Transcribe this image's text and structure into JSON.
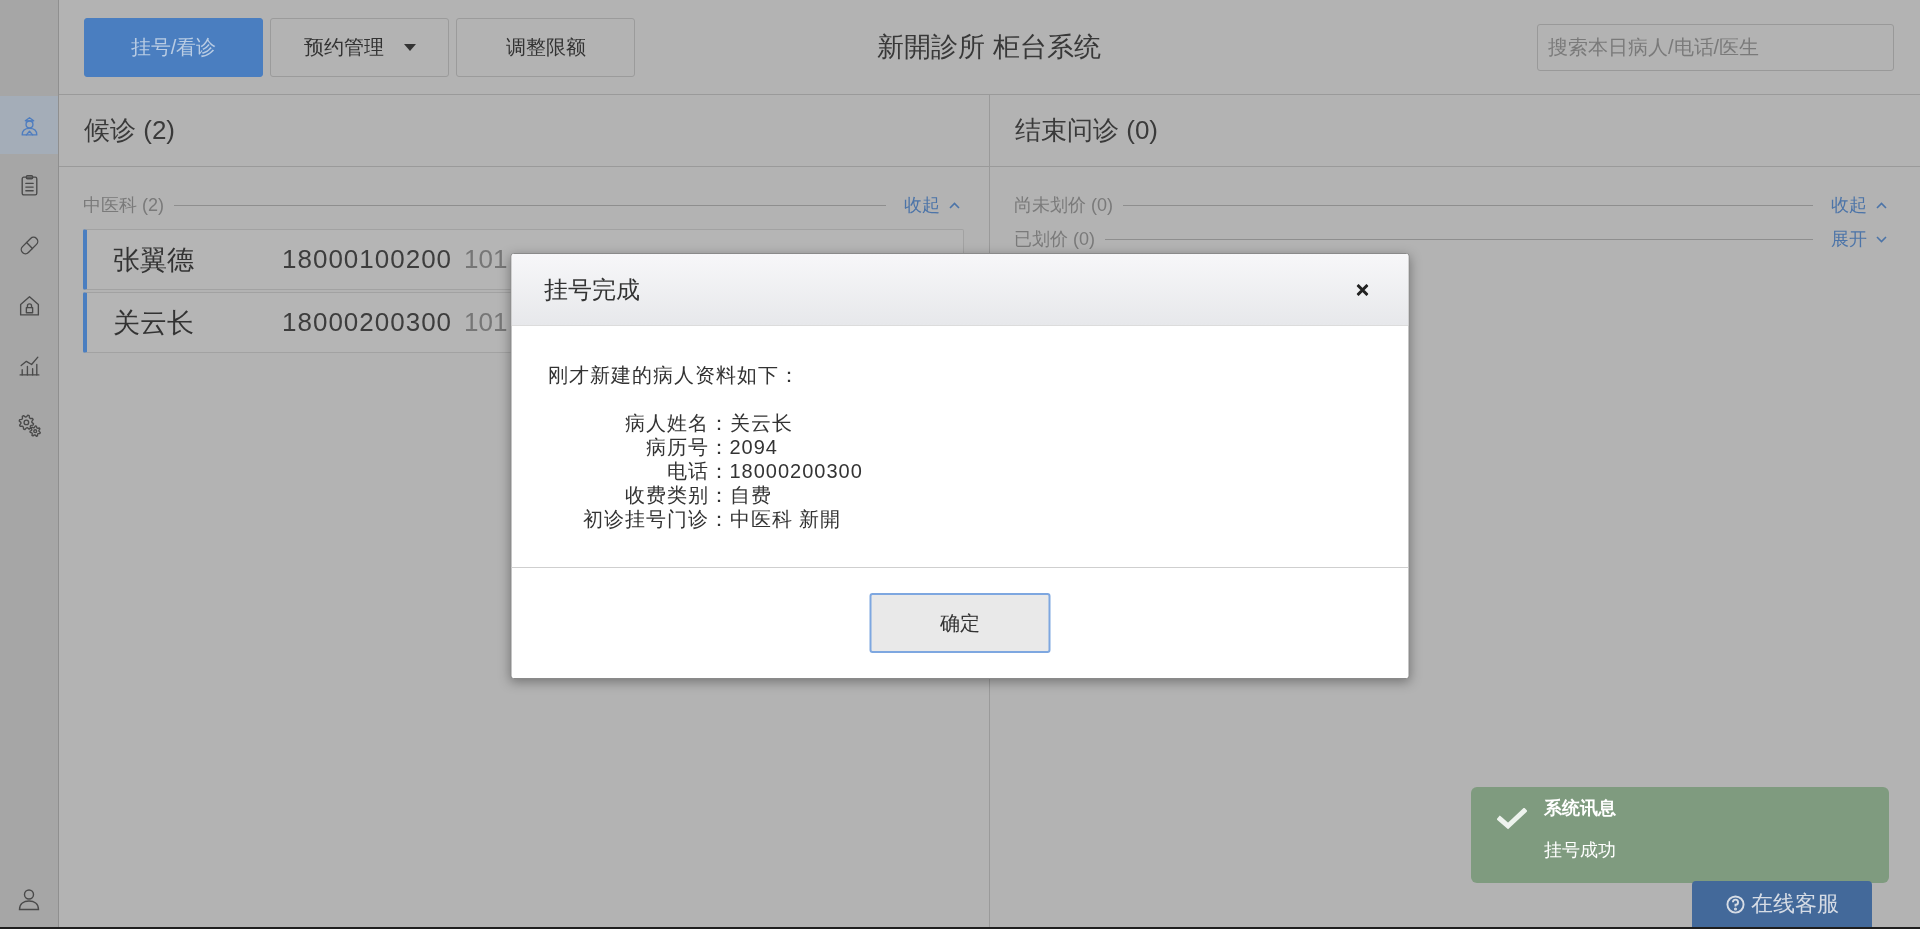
{
  "sidebar": {
    "items": [
      {
        "kind": "person",
        "selected": true
      },
      {
        "kind": "clipboard",
        "selected": false
      },
      {
        "kind": "pill",
        "selected": false
      },
      {
        "kind": "house",
        "selected": false
      },
      {
        "kind": "chart",
        "selected": false
      },
      {
        "kind": "gears",
        "selected": false
      }
    ]
  },
  "toolbar": {
    "buttons": [
      {
        "label": "挂号/看诊",
        "kind": "plain",
        "selected": true
      },
      {
        "label": "预约管理",
        "kind": "dropdown",
        "selected": false
      },
      {
        "label": "调整限额",
        "kind": "plain",
        "selected": false
      }
    ]
  },
  "header": {
    "title": "新開診所 柜台系统",
    "search": {
      "placeholder": "搜索本日病人/电话/医生"
    }
  },
  "panels": [
    {
      "title": "候诊 (2)",
      "groups": [
        {
          "label": "中医科 (2)",
          "toggle": "收起",
          "expanded": true,
          "patients": [
            {
              "name": "张翼德",
              "phone": "18000100200",
              "visit": "101"
            },
            {
              "name": "关云长",
              "phone": "18000200300",
              "visit": "101"
            }
          ]
        }
      ]
    },
    {
      "title": "结束问诊 (0)",
      "groups": [
        {
          "label": "尚未划价 (0)",
          "toggle": "收起",
          "expanded": true
        },
        {
          "label": "已划价 (0)",
          "toggle": "展开",
          "expanded": false
        }
      ]
    }
  ],
  "dialog": {
    "title": "挂号完成",
    "message": "刚才新建的病人资料如下：",
    "fields": [
      {
        "label": "病人姓名：",
        "value": "关云长"
      },
      {
        "label": "病历号：",
        "value": "2094"
      },
      {
        "label": "电话：",
        "value": "18000200300"
      },
      {
        "label": "收费类别：",
        "value": "自费"
      },
      {
        "label": "初诊挂号门诊：",
        "value": "中医科 新開"
      }
    ],
    "button": "确定"
  },
  "toast": {
    "title": "系统讯息",
    "message": "挂号成功"
  },
  "help_button": {
    "label": "在线客服"
  }
}
